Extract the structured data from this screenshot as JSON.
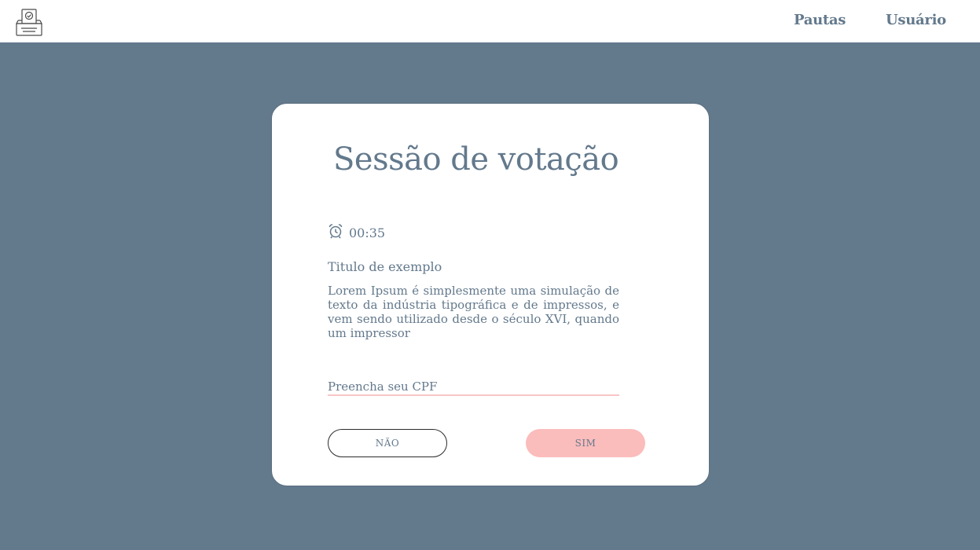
{
  "nav": {
    "logo_icon": "ballot-box-icon",
    "links": [
      "Pautas",
      "Usuário"
    ]
  },
  "session": {
    "title": "Sessão de votação",
    "timer_icon": "alarm-clock-icon",
    "timer": "00:35",
    "item_title": "Titulo de exemplo",
    "item_description": "Lorem Ipsum é simplesmente uma simulação de texto da indústria tipográfica e de impressos, e vem sendo utilizado desde o século XVI, quando um impressor",
    "cpf_placeholder": "Preencha seu CPF",
    "cpf_value": "",
    "button_no": "NÃO",
    "button_yes": "SIM"
  },
  "colors": {
    "background": "#63798c",
    "text": "#63798c",
    "accent_pink": "#fbbcbc",
    "card": "#ffffff"
  }
}
